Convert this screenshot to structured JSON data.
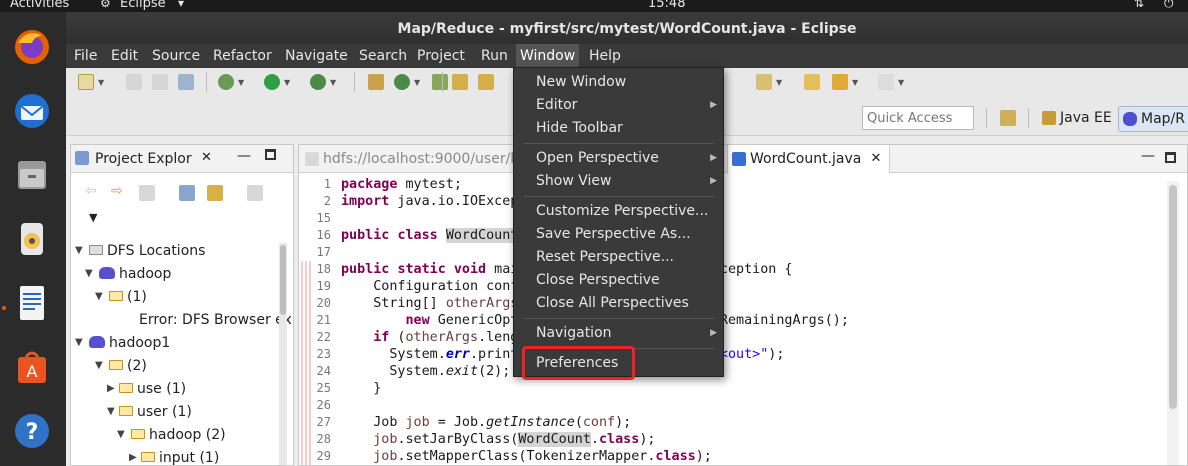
{
  "topbar": {
    "activities": "Activities",
    "app_name": "Eclipse",
    "clock": "15:48"
  },
  "window": {
    "title": "Map/Reduce - myfirst/src/mytest/WordCount.java - Eclipse"
  },
  "menubar": {
    "items": [
      "File",
      "Edit",
      "Source",
      "Refactor",
      "Navigate",
      "Search",
      "Project",
      "Run",
      "Window",
      "Help"
    ],
    "active": "Window"
  },
  "toolbar": {
    "quick_access_placeholder": "Quick Access",
    "perspectives": [
      "Java EE",
      "Map/R"
    ]
  },
  "explorer": {
    "tab_label": "Project Explor",
    "tree": [
      {
        "label": "DFS Locations"
      },
      {
        "label": "hadoop"
      },
      {
        "label": "(1)"
      },
      {
        "label": "Error: DFS Browser ex"
      },
      {
        "label": "hadoop1"
      },
      {
        "label": "(2)"
      },
      {
        "label": "use (1)"
      },
      {
        "label": "user (1)"
      },
      {
        "label": "hadoop (2)"
      },
      {
        "label": "input (1)"
      }
    ]
  },
  "editor": {
    "tabs": [
      {
        "label": "hdfs://localhost:9000/user/h"
      },
      {
        "label": "WordCount.java"
      }
    ],
    "line_numbers": [
      "1",
      "2",
      "15",
      "16",
      "17",
      "18",
      "19",
      "20",
      "21",
      "22",
      "23",
      "24",
      "25",
      "26",
      "27",
      "28",
      "29"
    ]
  },
  "window_menu": {
    "items": [
      {
        "label": "New Window",
        "submenu": false
      },
      {
        "label": "Editor",
        "submenu": true
      },
      {
        "label": "Hide Toolbar",
        "submenu": false
      },
      {
        "label": "Open Perspective",
        "submenu": true
      },
      {
        "label": "Show View",
        "submenu": true
      },
      {
        "label": "Customize Perspective...",
        "submenu": false
      },
      {
        "label": "Save Perspective As...",
        "submenu": false
      },
      {
        "label": "Reset Perspective...",
        "submenu": false
      },
      {
        "label": "Close Perspective",
        "submenu": false
      },
      {
        "label": "Close All Perspectives",
        "submenu": false
      },
      {
        "label": "Navigation",
        "submenu": true
      },
      {
        "label": "Preferences",
        "submenu": false
      }
    ],
    "highlighted": "Preferences"
  },
  "colors": {
    "highlight_box": "#ee2323",
    "menu_bg": "#3a3a3a",
    "keyword": "#7f0055"
  }
}
